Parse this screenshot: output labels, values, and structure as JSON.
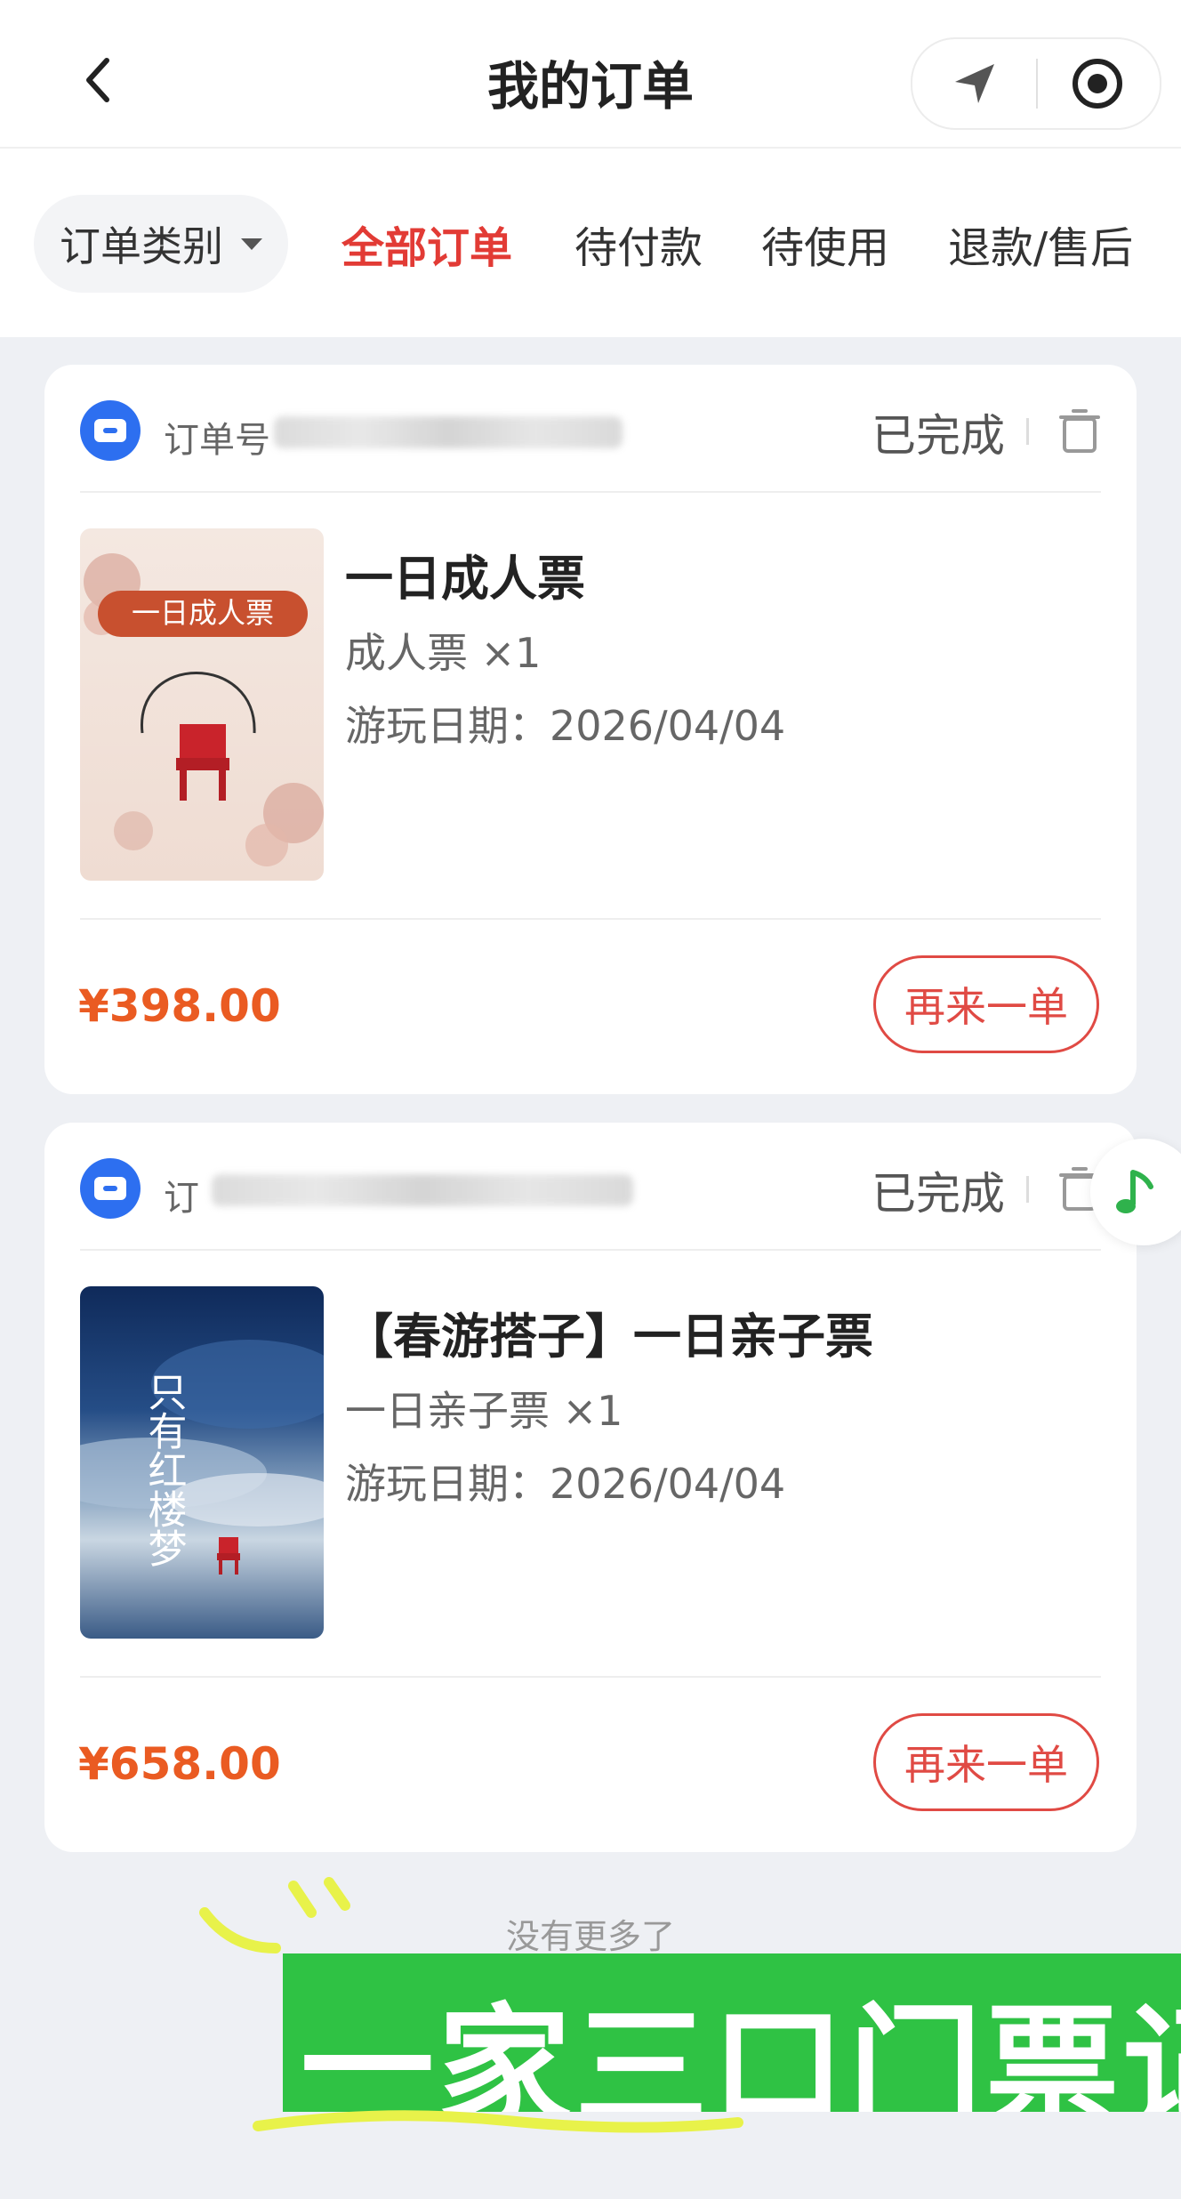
{
  "header": {
    "title": "我的订单",
    "back_icon": "chevron-left-icon",
    "capsule": {
      "location_icon": "navigation-arrow-icon",
      "close_icon": "target-circle-icon"
    }
  },
  "filters": {
    "category_label": "订单类别",
    "tabs": [
      {
        "label": "全部订单",
        "active": true
      },
      {
        "label": "待付款",
        "active": false
      },
      {
        "label": "待使用",
        "active": false
      },
      {
        "label": "退款/售后",
        "active": false
      }
    ]
  },
  "orders": [
    {
      "order_label": "订单号",
      "status": "已完成",
      "thumb_label": "一日成人票",
      "title": "一日成人票",
      "spec": "成人票 ×1",
      "date": "游玩日期：2026/04/04",
      "price": "¥398.00",
      "reorder_label": "再来一单"
    },
    {
      "order_label": "订",
      "status": "已完成",
      "thumb_label": "只有红楼梦",
      "title": "【春游搭子】一日亲子票",
      "spec": "一日亲子票 ×1",
      "date": "游玩日期：2026/04/04",
      "price": "¥658.00",
      "reorder_label": "再来一单"
    }
  ],
  "footer": {
    "no_more": "没有更多了"
  },
  "overlay": {
    "caption": "一家三口门票记录"
  },
  "colors": {
    "accent_red": "#e23b35",
    "price_orange": "#ea5b22",
    "brand_blue": "#2d6ff0",
    "overlay_green": "#2fc244"
  }
}
